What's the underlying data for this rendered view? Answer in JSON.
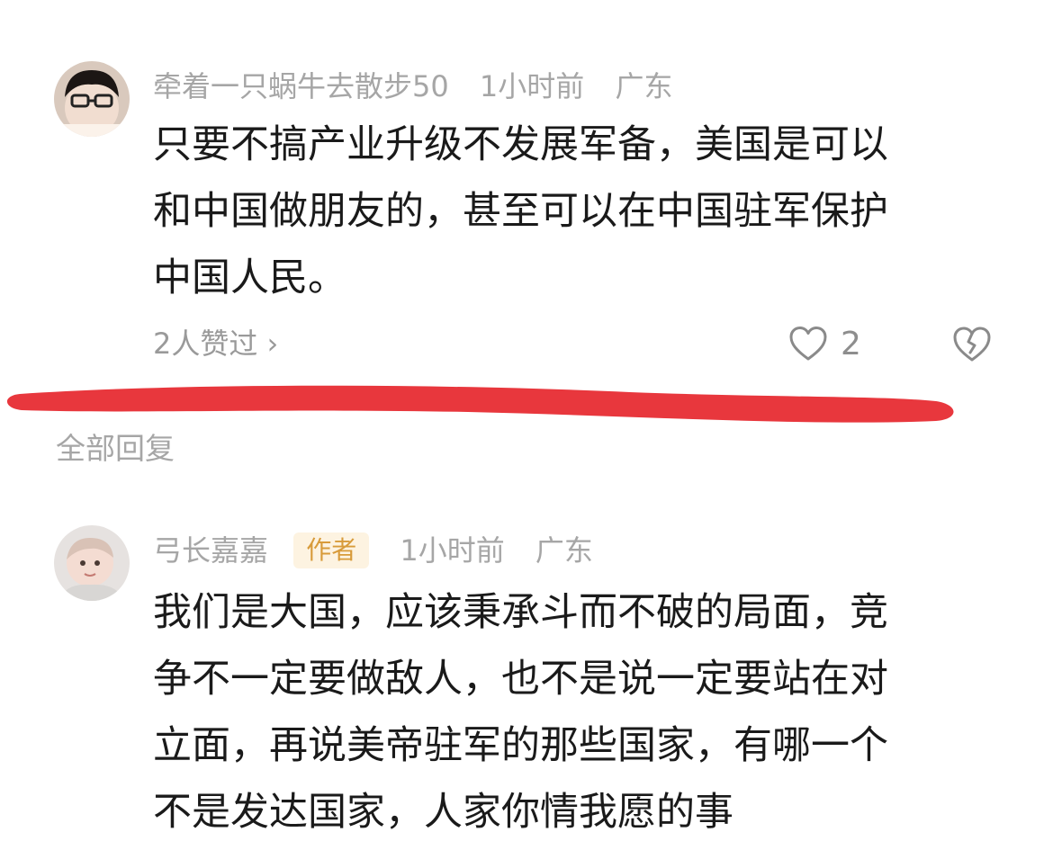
{
  "comment1": {
    "username": "牵着一只蜗牛去散步50",
    "time": "1小时前",
    "location": "广东",
    "lines": [
      "只要不搞产业升级不发展军备，美国是可以",
      "和中国做朋友的，甚至可以在中国驻军保护",
      "中国人民。"
    ],
    "likers": "2人赞过 ›",
    "like_count": "2"
  },
  "section_title": "全部回复",
  "reply": {
    "username": "弓长嘉嘉",
    "badge": "作者",
    "time": "1小时前",
    "location": "广东",
    "lines": [
      "我们是大国，应该秉承斗而不破的局面，竞",
      "争不一定要做敌人，也不是说一定要站在对",
      "立面，再说美帝驻军的那些国家，有哪一个",
      "不是发达国家，人家你情我愿的事"
    ]
  },
  "colors": {
    "red_mark": "#e8373d",
    "meta_gray": "#a6a6a6",
    "badge_bg": "#fdf3e1",
    "badge_text": "#d89b3a"
  },
  "icons": {
    "like": "heart-outline-icon",
    "dislike": "broken-heart-icon",
    "chevron": "chevron-right-icon"
  }
}
